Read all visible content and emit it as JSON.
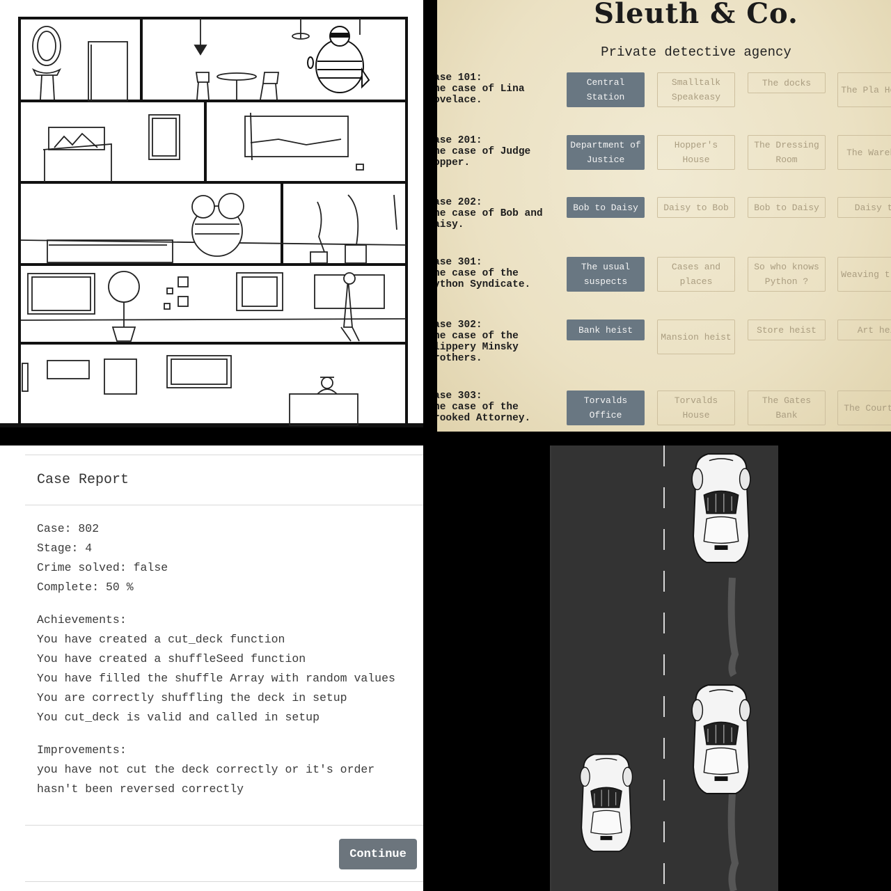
{
  "sleuth": {
    "title": "Sleuth & Co.",
    "subtitle": "Private detective agency",
    "cases": [
      {
        "label": "ase 101:\nhe case of Lina\novelace.",
        "buttons": [
          "Central Station",
          "Smalltalk Speakeasy",
          "The docks",
          "The Pla Hotel"
        ]
      },
      {
        "label": "ase 201:\nhe case of Judge\nopper.",
        "buttons": [
          "Department of Justice",
          "Hopper's House",
          "The Dressing Room",
          "The Warehou"
        ]
      },
      {
        "label": "ase 202:\nhe case of Bob and\naisy.",
        "buttons": [
          "Bob to Daisy",
          "Daisy to Bob",
          "Bob to Daisy",
          "Daisy to"
        ]
      },
      {
        "label": "ase 301:\nhe case of the\nython Syndicate.",
        "buttons": [
          "The usual suspects",
          "Cases and places",
          "So who knows Python ?",
          "Weaving t web"
        ]
      },
      {
        "label": "ase 302:\nhe case of the\nlippery Minsky\nrothers.",
        "buttons": [
          "Bank heist",
          "Mansion heist",
          "Store heist",
          "Art hei"
        ]
      },
      {
        "label": "ase 303:\nhe case of the\nrooked Attorney.",
        "buttons": [
          "Torvalds Office",
          "Torvalds House",
          "The Gates Bank",
          "The Courthou"
        ]
      }
    ]
  },
  "report": {
    "title": "Case Report",
    "case": "Case: 802",
    "stage": "Stage: 4",
    "crime_solved": "Crime solved: false",
    "complete": "Complete: 50 %",
    "achievements_heading": "Achievements:",
    "achievements": [
      "You have created a cut_deck function",
      "You have created a shuffleSeed function",
      "You have filled the shuffle Array with random values",
      "You are correctly shuffling the deck in setup",
      "You cut_deck is valid and called in setup"
    ],
    "improvements_heading": "Improvements:",
    "improvements": [
      "you have not cut the deck correctly or it's order",
      "hasn't been reversed correctly"
    ],
    "continue_label": "Continue"
  },
  "colors": {
    "parchment": "#ebe1c3",
    "active_button": "#697782",
    "inactive_text": "#aa9d80",
    "continue_button": "#6c757d",
    "road": "#333333"
  },
  "icons": [
    "car-sprite",
    "mirror-icon",
    "lamp-icon",
    "burglar-figure",
    "detective-figure"
  ]
}
